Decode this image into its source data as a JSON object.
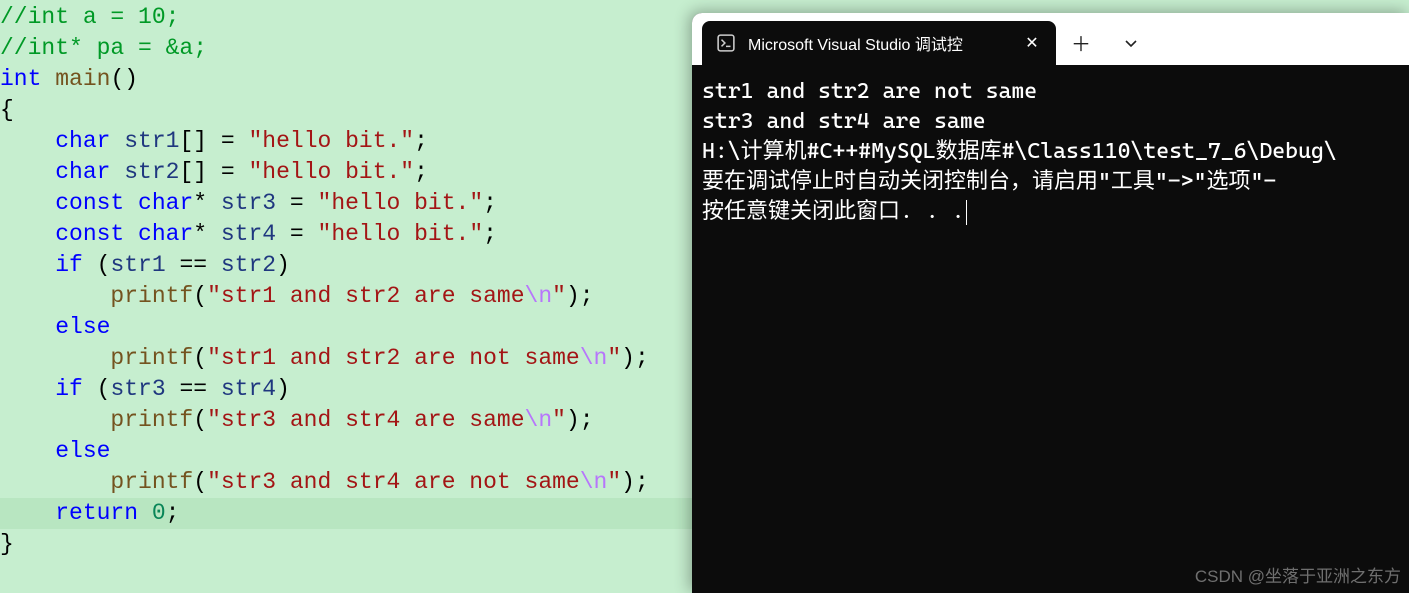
{
  "code": {
    "l1_comment": "//int a = 10;",
    "l2_comment": "//int* pa = &a;",
    "l3": {
      "type": "int",
      "func": " main",
      "paren": "()"
    },
    "l4_brace": "{",
    "l5": {
      "indent": "    ",
      "kw": "char",
      "var": " str1",
      "brackets": "[]",
      "eq": " = ",
      "str": "\"hello bit.\"",
      "semi": ";"
    },
    "l6": {
      "indent": "    ",
      "kw": "char",
      "var": " str2",
      "brackets": "[]",
      "eq": " = ",
      "str": "\"hello bit.\"",
      "semi": ";"
    },
    "l7": {
      "indent": "    ",
      "kw1": "const",
      "sp1": " ",
      "kw2": "char",
      "ptr": "*",
      "var": " str3",
      "eq": " = ",
      "str": "\"hello bit.\"",
      "semi": ";"
    },
    "l8": {
      "indent": "    ",
      "kw1": "const",
      "sp1": " ",
      "kw2": "char",
      "ptr": "*",
      "var": " str4",
      "eq": " = ",
      "str": "\"hello bit.\"",
      "semi": ";"
    },
    "l9": {
      "indent": "    ",
      "kw": "if",
      "open": " (",
      "v1": "str1",
      "op": " == ",
      "v2": "str2",
      "close": ")"
    },
    "l10": {
      "indent": "        ",
      "func": "printf",
      "open": "(",
      "str": "\"str1 and str2 are same",
      "esc": "\\n",
      "strend": "\"",
      "close": ");"
    },
    "l11": {
      "indent": "    ",
      "kw": "else"
    },
    "l12": {
      "indent": "        ",
      "func": "printf",
      "open": "(",
      "str": "\"str1 and str2 are not same",
      "esc": "\\n",
      "strend": "\"",
      "close": ");"
    },
    "l13": {
      "indent": "    ",
      "kw": "if",
      "open": " (",
      "v1": "str3",
      "op": " == ",
      "v2": "str4",
      "close": ")"
    },
    "l14": {
      "indent": "        ",
      "func": "printf",
      "open": "(",
      "str": "\"str3 and str4 are same",
      "esc": "\\n",
      "strend": "\"",
      "close": ");"
    },
    "l15": {
      "indent": "    ",
      "kw": "else"
    },
    "l16": {
      "indent": "        ",
      "func": "printf",
      "open": "(",
      "str": "\"str3 and str4 are not same",
      "esc": "\\n",
      "strend": "\"",
      "close": ");"
    },
    "l17": {
      "indent": "    ",
      "kw": "return",
      "sp": " ",
      "num": "0",
      "semi": ";"
    },
    "l18_brace": "}"
  },
  "terminal": {
    "tab_title": "Microsoft Visual Studio 调试控",
    "lines": {
      "out1": "str1 and str2 are not same",
      "out2": "str3 and str4 are same",
      "blank": "",
      "path": "H:\\计算机#C++#MySQL数据库#\\Class110\\test_7_6\\Debug\\",
      "msg1": "要在调试停止时自动关闭控制台，请启用\"工具\"->\"选项\"-",
      "msg2": "按任意键关闭此窗口. . ."
    }
  },
  "watermark": "CSDN @坐落于亚洲之东方"
}
